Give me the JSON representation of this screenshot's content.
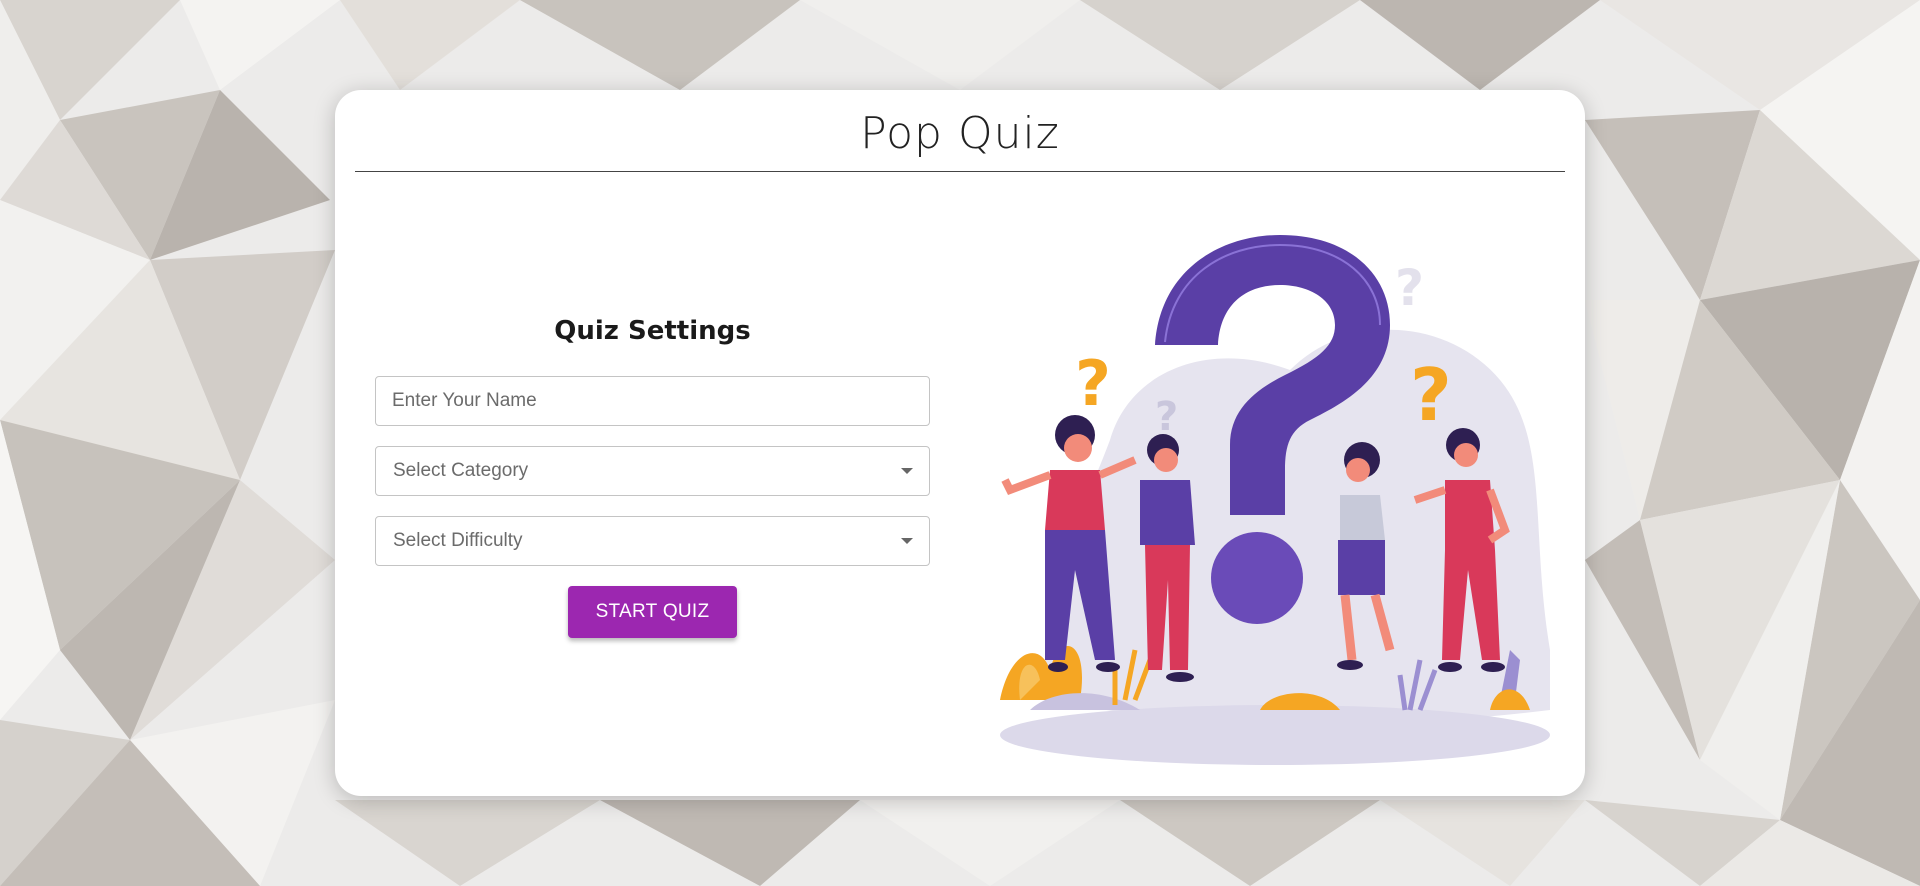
{
  "app": {
    "title": "Pop Quiz"
  },
  "form": {
    "heading": "Quiz Settings",
    "name_placeholder": "Enter Your Name",
    "category_label": "Select Category",
    "difficulty_label": "Select Difficulty",
    "start_label": "START QUIZ"
  },
  "colors": {
    "accent": "#9c27b0",
    "illustration_purple": "#5a3fa6",
    "illustration_orange": "#f5a623",
    "illustration_red": "#d9395a"
  },
  "icons": {
    "dropdown": "caret-down-icon",
    "illustration": "people-question-illustration"
  }
}
